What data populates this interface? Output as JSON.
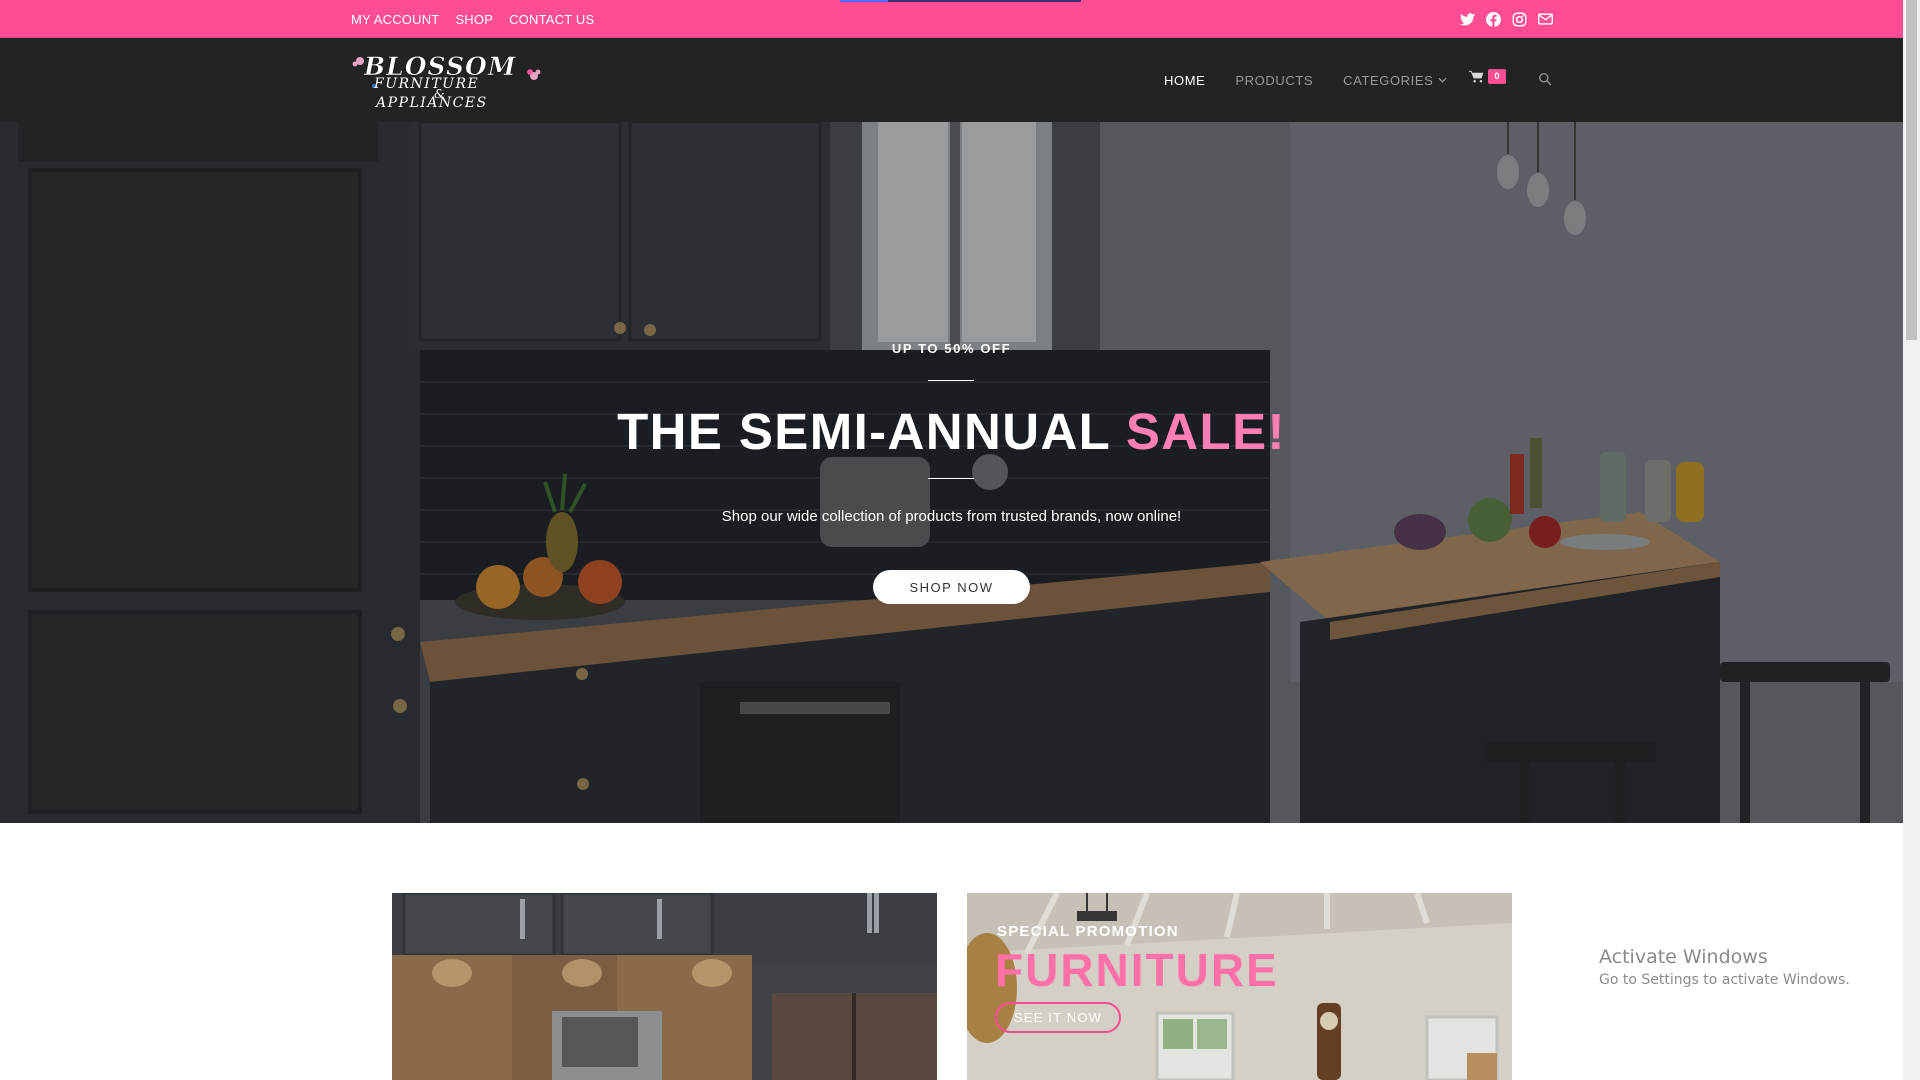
{
  "colors": {
    "brand_pink": "#ff4d94",
    "header_dark": "#222325",
    "accent_pink_text": "#ff7eb3"
  },
  "topbar": {
    "links": [
      "MY ACCOUNT",
      "SHOP",
      "CONTACT US"
    ],
    "social_icons": [
      "twitter-icon",
      "facebook-icon",
      "instagram-icon",
      "mail-icon"
    ]
  },
  "header": {
    "logo": {
      "line1": "BLOSSOM",
      "line2": "FURNITURE",
      "line3": "&",
      "line4": "APPLIANCES"
    },
    "nav": {
      "home": "HOME",
      "products": "PRODUCTS",
      "categories": "CATEGORIES"
    },
    "cart_count": "0"
  },
  "hero": {
    "eyebrow": "UP TO 50% OFF",
    "title_main": "THE SEMI-ANNUAL ",
    "title_accent": "SALE!",
    "subtitle": "Shop our wide collection of products from trusted brands, now online!",
    "button": "SHOP NOW"
  },
  "promos": [
    {
      "eyebrow": "SPECIAL PROMOTION",
      "title": "FURNITURE",
      "button": "SEE IT NOW"
    }
  ],
  "watermark": {
    "title": "Activate Windows",
    "subtitle": "Go to Settings to activate Windows."
  }
}
